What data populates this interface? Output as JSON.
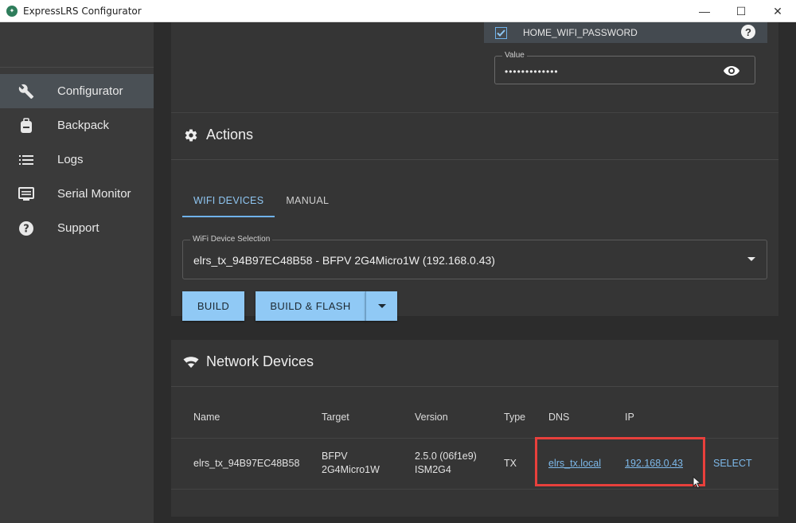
{
  "window": {
    "title": "ExpressLRS Configurator",
    "controls": {
      "minimize": "—",
      "maximize": "☐",
      "close": "✕"
    }
  },
  "sidebar": {
    "items": [
      {
        "label": "Configurator",
        "icon": "wrench-icon",
        "active": true
      },
      {
        "label": "Backpack",
        "icon": "backpack-icon",
        "active": false
      },
      {
        "label": "Logs",
        "icon": "list-icon",
        "active": false
      },
      {
        "label": "Serial Monitor",
        "icon": "monitor-icon",
        "active": false
      },
      {
        "label": "Support",
        "icon": "help-circle-icon",
        "active": false
      }
    ]
  },
  "wifi": {
    "password_option_label": "HOME_WIFI_PASSWORD",
    "password_option_checked": true,
    "value_label": "Value",
    "value": "•••••••••••••"
  },
  "actions": {
    "title": "Actions",
    "tabs": [
      {
        "label": "WIFI DEVICES",
        "active": true
      },
      {
        "label": "MANUAL",
        "active": false
      }
    ],
    "device_select_label": "WiFi Device Selection",
    "device_select_value": "elrs_tx_94B97EC48B58 - BFPV 2G4Micro1W (192.168.0.43)",
    "build_label": "BUILD",
    "build_flash_label": "BUILD & FLASH"
  },
  "network": {
    "title": "Network Devices",
    "columns": [
      "Name",
      "Target",
      "Version",
      "Type",
      "DNS",
      "IP"
    ],
    "rows": [
      {
        "name": "elrs_tx_94B97EC48B58",
        "target_line1": "BFPV",
        "target_line2": "2G4Micro1W",
        "version_line1": "2.5.0 (06f1e9)",
        "version_line2": "ISM2G4",
        "type": "TX",
        "dns": "elrs_tx.local",
        "ip": "192.168.0.43",
        "action": "SELECT"
      }
    ]
  },
  "colors": {
    "accent": "#90c9f5",
    "link": "#7db9ea",
    "highlight": "#e8403c"
  }
}
